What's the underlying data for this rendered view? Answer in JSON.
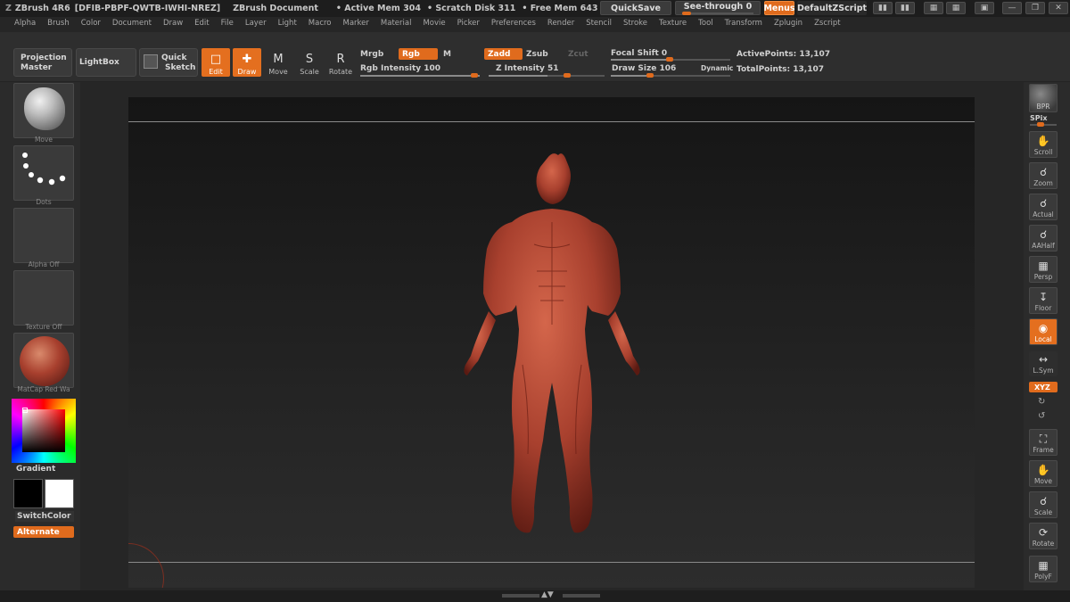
{
  "titlebar": {
    "app": "ZBrush 4R6",
    "serial": "[DFIB-PBPF-QWTB-IWHI-NREZ]",
    "document": "ZBrush Document",
    "active_mem": "• Active Mem 304",
    "scratch_disk": "• Scratch Disk 311",
    "free_mem": "• Free Mem 643 • Z",
    "quicksave": "QuickSave",
    "see_through": "See-through  0",
    "menus": "Menus",
    "default_zscript": "DefaultZScript"
  },
  "menu": [
    "Alpha",
    "Brush",
    "Color",
    "Document",
    "Draw",
    "Edit",
    "File",
    "Layer",
    "Light",
    "Macro",
    "Marker",
    "Material",
    "Movie",
    "Picker",
    "Preferences",
    "Render",
    "Stencil",
    "Stroke",
    "Texture",
    "Tool",
    "Transform",
    "Zplugin",
    "Zscript"
  ],
  "shelf": {
    "projection_master": [
      "Projection",
      "Master"
    ],
    "lightbox": "LightBox",
    "quick_sketch": [
      "Quick",
      "Sketch"
    ],
    "edit": "Edit",
    "draw": "Draw",
    "move": "Move",
    "scale": "Scale",
    "rotate": "Rotate",
    "mrgb": "Mrgb",
    "rgb": "Rgb",
    "m": "M",
    "rgb_intensity": "Rgb  Intensity 100",
    "zadd": "Zadd",
    "zsub": "Zsub",
    "zcut": "Zcut",
    "z_intensity": "Z Intensity 51",
    "focal_shift": "Focal Shift 0",
    "draw_size": "Draw Size 106",
    "dynamic": "Dynamic",
    "active_points": "ActivePoints: 13,107",
    "total_points": "TotalPoints: 13,107"
  },
  "left_tray": {
    "brush": "Move",
    "stroke": "Dots",
    "alpha": "Alpha  Off",
    "texture": "Texture  Off",
    "material": "MatCap  Red  Wa",
    "gradient": "Gradient",
    "switch_color": "SwitchColor",
    "alternate": "Alternate"
  },
  "right_tray": {
    "bpr": "BPR",
    "spix": "SPix",
    "scroll": "Scroll",
    "zoom": "Zoom",
    "actual": "Actual",
    "aahalf": "AAHalf",
    "persp": "Persp",
    "floor": "Floor",
    "local": "Local",
    "lsym": "L.Sym",
    "xyz": "XYZ",
    "frame": "Frame",
    "move": "Move",
    "scale": "Scale",
    "rotate": "Rotate",
    "polyf": "PolyF"
  },
  "colors": {
    "accent": "#e06b1d",
    "model": "#a8402e",
    "main_color": "#000000",
    "secondary_color": "#ffffff"
  },
  "icons": {
    "title_glyph": "zbrush-z-icon",
    "ui_buttons": [
      "layout-icon",
      "layout-icon-2",
      "window-icon",
      "window-icon-2",
      "lock-icon",
      "minimize-icon",
      "restore-icon",
      "close-icon"
    ]
  }
}
